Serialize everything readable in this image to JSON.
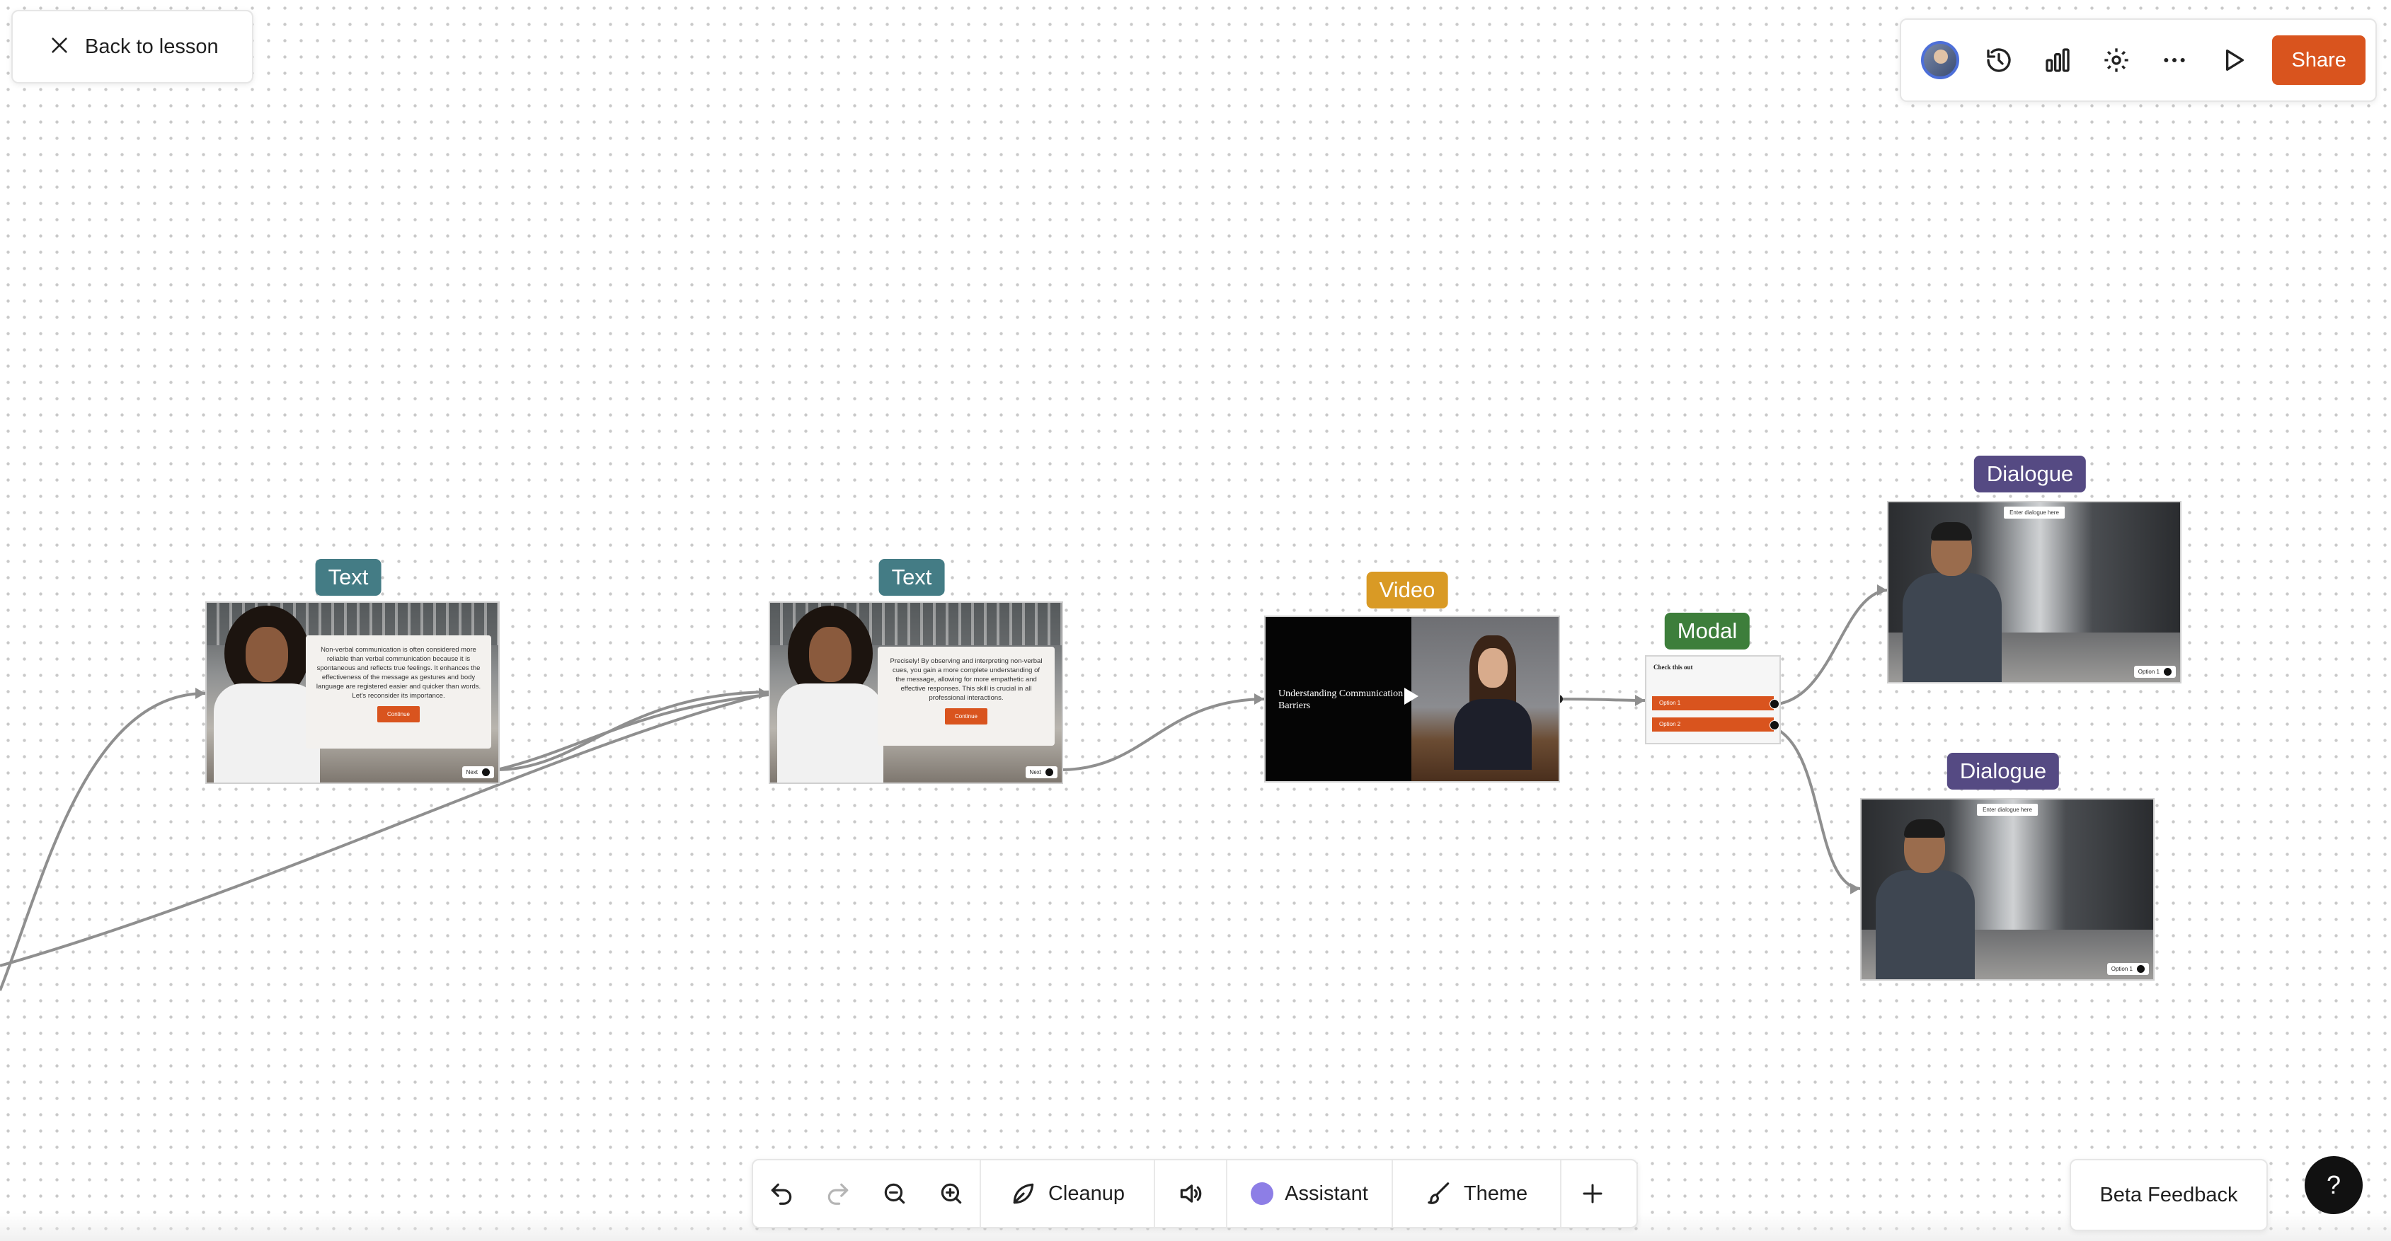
{
  "header": {
    "back_label": "Back to lesson",
    "share_label": "Share",
    "accent_color": "#d9541e"
  },
  "toolbar_icons": [
    "avatar",
    "history-icon",
    "analytics-icon",
    "gear-icon",
    "more-icon",
    "play-icon"
  ],
  "nodes": {
    "text1": {
      "tag": "Text",
      "body": "Non-verbal communication is often considered more reliable than verbal communication because it is spontaneous and reflects true feelings. It enhances the effectiveness of the message as gestures and body language are registered easier and quicker than words. Let's reconsider its importance.",
      "button": "Continue",
      "next": "Next"
    },
    "text2": {
      "tag": "Text",
      "body": "Precisely! By observing and interpreting non-verbal cues, you gain a more complete understanding of the message, allowing for more empathetic and effective responses. This skill is crucial in all professional interactions.",
      "button": "Continue",
      "next": "Next"
    },
    "video": {
      "tag": "Video",
      "title": "Understanding Communication Barriers"
    },
    "modal": {
      "tag": "Modal",
      "title": "Check this out",
      "options": [
        "Option 1",
        "Option 2"
      ]
    },
    "dialogue1": {
      "tag": "Dialogue",
      "placeholder": "Enter dialogue here",
      "option": "Option 1"
    },
    "dialogue2": {
      "tag": "Dialogue",
      "placeholder": "Enter dialogue here",
      "option": "Option 1"
    }
  },
  "bottom_toolbar": {
    "cleanup": "Cleanup",
    "assistant": "Assistant",
    "theme": "Theme"
  },
  "beta_feedback": "Beta Feedback",
  "help": "?"
}
